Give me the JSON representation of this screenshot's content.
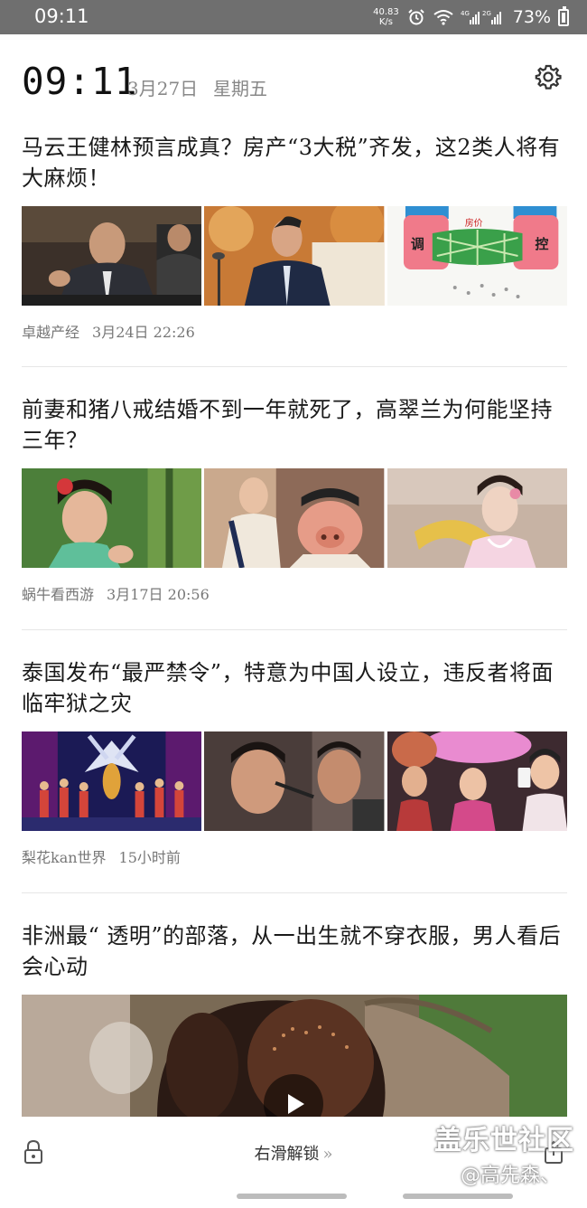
{
  "status_bar": {
    "time": "09:11",
    "net_speed_value": "40.83",
    "net_speed_unit": "K/s",
    "signal_labels": "4G 2G",
    "battery": "73%"
  },
  "lockscreen": {
    "clock": "09:11",
    "date": "3月27日",
    "weekday": "星期五"
  },
  "articles": [
    {
      "title": "马云王健林预言成真？房产“3大税”齐发，这2类人将有大麻烦！",
      "source": "卓越产经",
      "time": "3月24日 22:26",
      "images": [
        "photo-jack-ma",
        "photo-wang-jianlin",
        "cartoon-housing-control"
      ],
      "image_text": [
        "调",
        "房价",
        "控"
      ]
    },
    {
      "title": "前妻和猪八戒结婚不到一年就死了，高翠兰为何能坚持三年？",
      "source": "蜗牛看西游",
      "time": "3月17日 20:56",
      "images": [
        "photo-actress-green",
        "photo-zhubajie",
        "photo-actress-pink"
      ]
    },
    {
      "title": "泰国发布“最严禁令”，特意为中国人设立，违反者将面临牢狱之灾",
      "source": "梨花kan世界",
      "time": "15小时前",
      "images": [
        "photo-stage-show",
        "photo-makeup",
        "photo-performers-selfie"
      ]
    },
    {
      "title": "非洲最“ 透明”的部落，从一出生就不穿衣服，男人看后会心动",
      "images": [
        "video-thumbnail-tribe"
      ]
    }
  ],
  "bottom": {
    "unlock_label": "右滑解锁",
    "unlock_arrows": "»"
  },
  "watermark": {
    "site": "盖乐世社区",
    "user": "@高先森、"
  },
  "colors": {
    "status_bar_bg": "#6f6f6f",
    "meta_text": "#777777",
    "title_text": "#1a1a1a"
  }
}
